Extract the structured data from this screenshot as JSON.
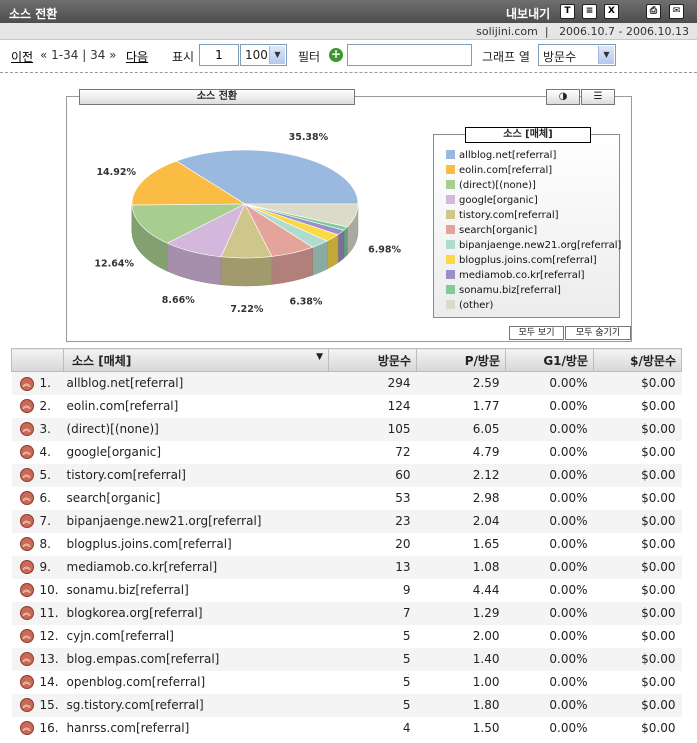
{
  "header": {
    "title": "소스 전환",
    "export_label": "내보내기",
    "export_icons": [
      {
        "name": "txt-export-icon",
        "glyph": "T"
      },
      {
        "name": "xml-export-icon",
        "glyph": "≡"
      },
      {
        "name": "excel-export-icon",
        "glyph": "X"
      },
      {
        "name": "print-icon",
        "glyph": "⎙"
      },
      {
        "name": "email-icon",
        "glyph": "✉"
      }
    ]
  },
  "info": {
    "site": "solijini.com",
    "date_range": "2006.10.7 - 2006.10.13"
  },
  "toolbar": {
    "prev_label": "이전",
    "range_text": "« 1-34 | 34 »",
    "next_label": "다음",
    "show_label": "표시",
    "start_value": "1",
    "page_size": "100",
    "filter_label": "필터",
    "filter_value": "",
    "graph_col_label": "그래프 열",
    "graph_col_value": "방문수"
  },
  "chart": {
    "tab_title": "소스 전환",
    "legend_title": "소스 [매체]",
    "show_all_label": "모두 보기",
    "hide_all_label": "모두 숨기기"
  },
  "chart_data": {
    "type": "pie",
    "title": "소스 전환",
    "labels": [
      "allblog.net[referral]",
      "eolin.com[referral]",
      "(direct)[(none)]",
      "google[organic]",
      "tistory.com[referral]",
      "search[organic]",
      "bipanjaenge.new21.org[referral]",
      "blogplus.joins.com[referral]",
      "mediamob.co.kr[referral]",
      "sonamu.biz[referral]",
      "(other)"
    ],
    "values": [
      35.38,
      14.92,
      12.64,
      8.66,
      7.22,
      6.38,
      2.77,
      2.41,
      1.56,
      1.08,
      6.98
    ],
    "value_labels": [
      "35.38%",
      "14.92%",
      "12.64%",
      "8.66%",
      "7.22%",
      "6.38%",
      "",
      "",
      "",
      "",
      "6.98%"
    ],
    "colors": [
      "#9ab9de",
      "#fbbc44",
      "#a7cd8f",
      "#d3b7dd",
      "#cfc68c",
      "#e4a49c",
      "#b0dccf",
      "#f9d946",
      "#9c8fc8",
      "#80cc99",
      "#dcdacb"
    ],
    "legend_position": "right"
  },
  "table": {
    "columns": [
      "소스 [매체]",
      "방문수",
      "P/방문",
      "G1/방문",
      "$/방문수"
    ],
    "rows": [
      {
        "rank": "1.",
        "source": "allblog.net[referral]",
        "visits": "294",
        "pages": "2.59",
        "goal": "0.00%",
        "value": "$0.00"
      },
      {
        "rank": "2.",
        "source": "eolin.com[referral]",
        "visits": "124",
        "pages": "1.77",
        "goal": "0.00%",
        "value": "$0.00"
      },
      {
        "rank": "3.",
        "source": "(direct)[(none)]",
        "visits": "105",
        "pages": "6.05",
        "goal": "0.00%",
        "value": "$0.00"
      },
      {
        "rank": "4.",
        "source": "google[organic]",
        "visits": "72",
        "pages": "4.79",
        "goal": "0.00%",
        "value": "$0.00"
      },
      {
        "rank": "5.",
        "source": "tistory.com[referral]",
        "visits": "60",
        "pages": "2.12",
        "goal": "0.00%",
        "value": "$0.00"
      },
      {
        "rank": "6.",
        "source": "search[organic]",
        "visits": "53",
        "pages": "2.98",
        "goal": "0.00%",
        "value": "$0.00"
      },
      {
        "rank": "7.",
        "source": "bipanjaenge.new21.org[referral]",
        "visits": "23",
        "pages": "2.04",
        "goal": "0.00%",
        "value": "$0.00"
      },
      {
        "rank": "8.",
        "source": "blogplus.joins.com[referral]",
        "visits": "20",
        "pages": "1.65",
        "goal": "0.00%",
        "value": "$0.00"
      },
      {
        "rank": "9.",
        "source": "mediamob.co.kr[referral]",
        "visits": "13",
        "pages": "1.08",
        "goal": "0.00%",
        "value": "$0.00"
      },
      {
        "rank": "10.",
        "source": "sonamu.biz[referral]",
        "visits": "9",
        "pages": "4.44",
        "goal": "0.00%",
        "value": "$0.00"
      },
      {
        "rank": "11.",
        "source": "blogkorea.org[referral]",
        "visits": "7",
        "pages": "1.29",
        "goal": "0.00%",
        "value": "$0.00"
      },
      {
        "rank": "12.",
        "source": "cyjn.com[referral]",
        "visits": "5",
        "pages": "2.00",
        "goal": "0.00%",
        "value": "$0.00"
      },
      {
        "rank": "13.",
        "source": "blog.empas.com[referral]",
        "visits": "5",
        "pages": "1.40",
        "goal": "0.00%",
        "value": "$0.00"
      },
      {
        "rank": "14.",
        "source": "openblog.com[referral]",
        "visits": "5",
        "pages": "1.00",
        "goal": "0.00%",
        "value": "$0.00"
      },
      {
        "rank": "15.",
        "source": "sg.tistory.com[referral]",
        "visits": "5",
        "pages": "1.80",
        "goal": "0.00%",
        "value": "$0.00"
      },
      {
        "rank": "16.",
        "source": "hanrss.com[referral]",
        "visits": "4",
        "pages": "1.50",
        "goal": "0.00%",
        "value": "$0.00"
      }
    ]
  }
}
